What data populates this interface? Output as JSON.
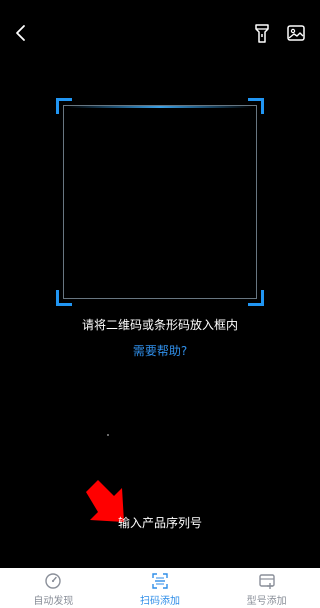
{
  "header": {
    "back_icon": "chevron-left-icon",
    "flash_icon": "flashlight-icon",
    "gallery_icon": "image-icon"
  },
  "scanner": {
    "hint": "请将二维码或条形码放入框内",
    "help_link": "需要帮助?",
    "accent_color": "#2196f3"
  },
  "serial_entry": {
    "label": "输入产品序列号"
  },
  "bottom_nav": {
    "items": [
      {
        "label": "自动发现",
        "icon": "compass-icon",
        "active": false
      },
      {
        "label": "扫码添加",
        "icon": "scan-icon",
        "active": true
      },
      {
        "label": "型号添加",
        "icon": "model-add-icon",
        "active": false
      }
    ],
    "active_color": "#2f8ee8",
    "inactive_color": "#8a8f99"
  }
}
